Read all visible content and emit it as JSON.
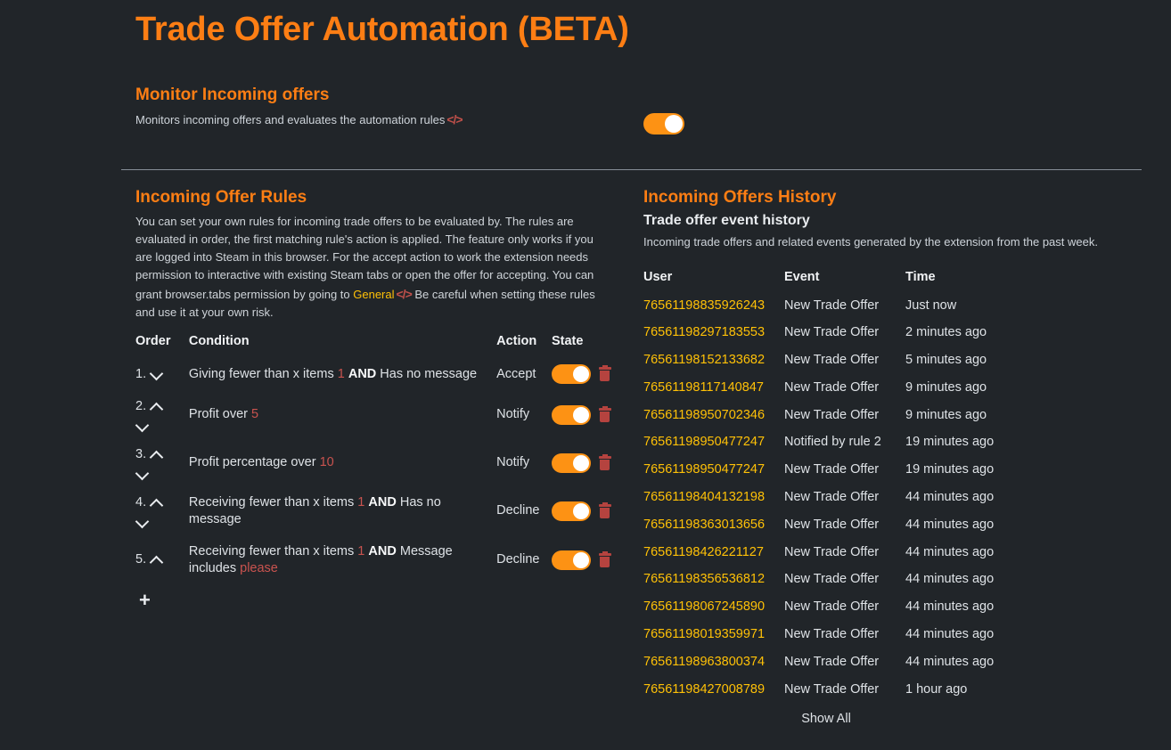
{
  "page": {
    "title": "Trade Offer Automation (BETA)",
    "accent_color": "#fd7e14",
    "background_color": "#212529",
    "link_color": "#ffc107",
    "value_color": "#c9534f",
    "toggle_on_color": "#fd9214",
    "trash_color": "#b5433f"
  },
  "monitor": {
    "heading": "Monitor Incoming offers",
    "description": "Monitors incoming offers and evaluates the automation rules",
    "code_icon": "</>",
    "toggle_state": "on"
  },
  "rules": {
    "heading": "Incoming Offer Rules",
    "description_part1": "You can set your own rules for incoming trade offers to be evaluated by. The rules are evaluated in order, the first matching rule's action is applied. The feature only works if you are logged into Steam in this browser. For the accept action to work the extension needs permission to interactive with existing Steam tabs or open the offer for accepting. You can grant browser.tabs permission by going to ",
    "general_link": "General",
    "code_icon": "</>",
    "description_part2": " Be careful when setting these rules and use it at your own risk.",
    "columns": {
      "order": "Order",
      "condition": "Condition",
      "action": "Action",
      "state": "State"
    },
    "add_button": "+",
    "items": [
      {
        "order": "1.",
        "can_move_up": false,
        "can_move_down": true,
        "cond_pre": "Giving fewer than x items",
        "cond_value": "1",
        "cond_join": "AND",
        "cond_post": "Has no message",
        "cond_value2": "",
        "action": "Accept",
        "state": "on"
      },
      {
        "order": "2.",
        "can_move_up": true,
        "can_move_down": true,
        "cond_pre": "Profit over",
        "cond_value": "5",
        "cond_join": "",
        "cond_post": "",
        "cond_value2": "",
        "action": "Notify",
        "state": "on"
      },
      {
        "order": "3.",
        "can_move_up": true,
        "can_move_down": true,
        "cond_pre": "Profit percentage over",
        "cond_value": "10",
        "cond_join": "",
        "cond_post": "",
        "cond_value2": "",
        "action": "Notify",
        "state": "on"
      },
      {
        "order": "4.",
        "can_move_up": true,
        "can_move_down": true,
        "cond_pre": "Receiving fewer than x items",
        "cond_value": "1",
        "cond_join": "AND",
        "cond_post": "Has no message",
        "cond_value2": "",
        "action": "Decline",
        "state": "on"
      },
      {
        "order": "5.",
        "can_move_up": true,
        "can_move_down": false,
        "cond_pre": "Receiving fewer than x items",
        "cond_value": "1",
        "cond_join": "AND",
        "cond_post": "Message includes",
        "cond_value2": "please",
        "action": "Decline",
        "state": "on"
      }
    ]
  },
  "history": {
    "heading": "Incoming Offers History",
    "subheading": "Trade offer event history",
    "description": "Incoming trade offers and related events generated by the extension from the past week.",
    "columns": {
      "user": "User",
      "event": "Event",
      "time": "Time"
    },
    "show_all": "Show All",
    "rows": [
      {
        "user": "76561198835926243",
        "event": "New Trade Offer",
        "time": "Just now"
      },
      {
        "user": "76561198297183553",
        "event": "New Trade Offer",
        "time": "2 minutes ago"
      },
      {
        "user": "76561198152133682",
        "event": "New Trade Offer",
        "time": "5 minutes ago"
      },
      {
        "user": "76561198117140847",
        "event": "New Trade Offer",
        "time": "9 minutes ago"
      },
      {
        "user": "76561198950702346",
        "event": "New Trade Offer",
        "time": "9 minutes ago"
      },
      {
        "user": "76561198950477247",
        "event": "Notified by rule 2",
        "time": "19 minutes ago"
      },
      {
        "user": "76561198950477247",
        "event": "New Trade Offer",
        "time": "19 minutes ago"
      },
      {
        "user": "76561198404132198",
        "event": "New Trade Offer",
        "time": "44 minutes ago"
      },
      {
        "user": "76561198363013656",
        "event": "New Trade Offer",
        "time": "44 minutes ago"
      },
      {
        "user": "76561198426221127",
        "event": "New Trade Offer",
        "time": "44 minutes ago"
      },
      {
        "user": "76561198356536812",
        "event": "New Trade Offer",
        "time": "44 minutes ago"
      },
      {
        "user": "76561198067245890",
        "event": "New Trade Offer",
        "time": "44 minutes ago"
      },
      {
        "user": "76561198019359971",
        "event": "New Trade Offer",
        "time": "44 minutes ago"
      },
      {
        "user": "76561198963800374",
        "event": "New Trade Offer",
        "time": "44 minutes ago"
      },
      {
        "user": "76561198427008789",
        "event": "New Trade Offer",
        "time": "1 hour ago"
      }
    ]
  }
}
